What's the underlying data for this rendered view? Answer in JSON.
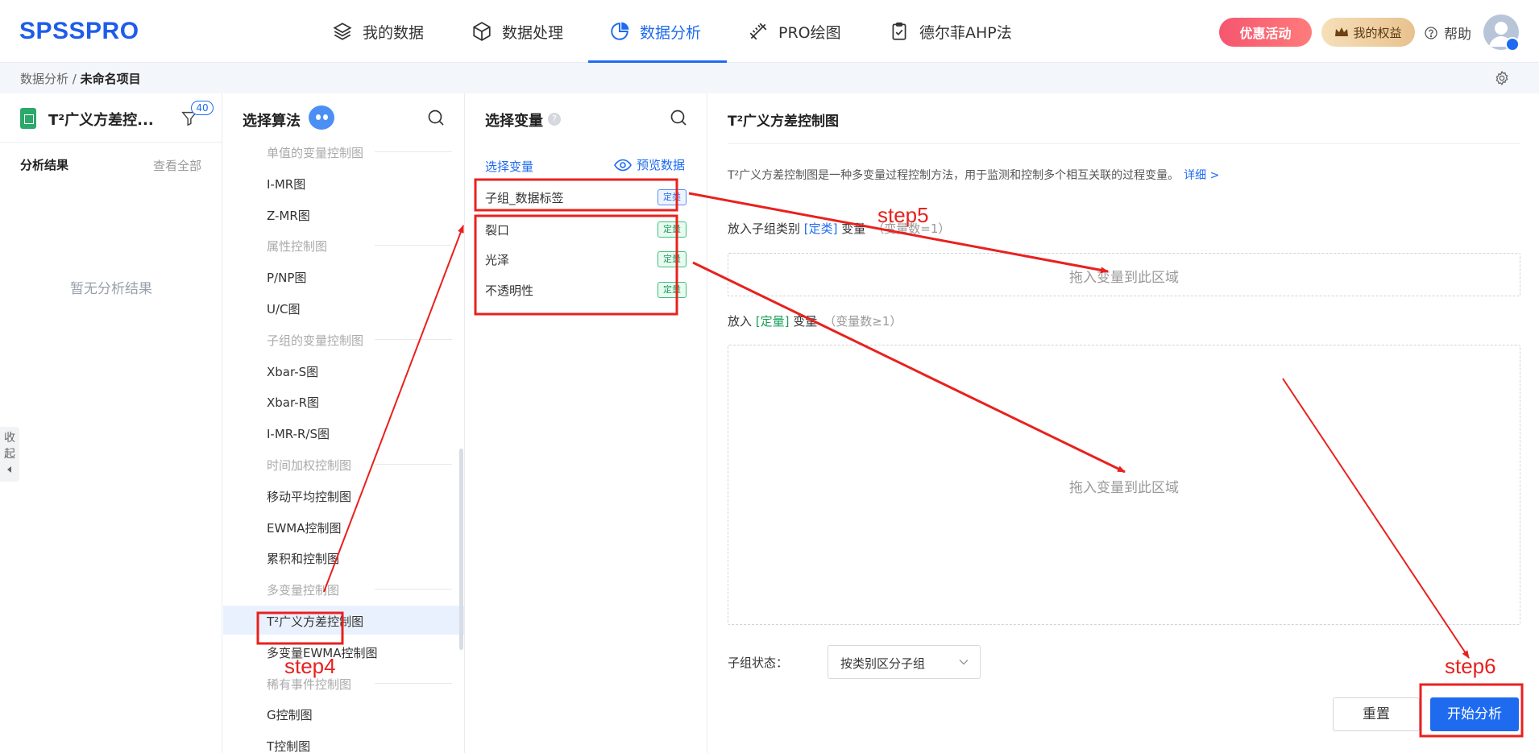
{
  "app": {
    "logo": "SPSSPRO",
    "nav": [
      {
        "label": "我的数据",
        "icon": "layers-icon"
      },
      {
        "label": "数据处理",
        "icon": "cube-icon"
      },
      {
        "label": "数据分析",
        "icon": "pie-chart-icon"
      },
      {
        "label": "PRO绘图",
        "icon": "ruler-pencil-icon"
      },
      {
        "label": "德尔菲AHP法",
        "icon": "clipboard-icon"
      }
    ],
    "active_nav": "数据分析",
    "promo_label": "优惠活动",
    "rights_label": "我的权益",
    "help_label": "帮助",
    "colors": {
      "accent": "#1e6bf0",
      "promo": "#f5566f",
      "category_tag": "#1e6bf0",
      "quantity_tag": "#17a05a",
      "annotation": "#e8211e"
    }
  },
  "breadcrumb": {
    "parent": "数据分析",
    "separator": " / ",
    "current": "未命名项目"
  },
  "left_panel": {
    "project_title": "T²广义方差控...",
    "filter_count": "40",
    "results_title": "分析结果",
    "view_all": "查看全部",
    "empty_text": "暂无分析结果",
    "collapse_label": "收起"
  },
  "algorithms": {
    "title": "选择算法",
    "items": [
      {
        "label": "单值的变量控制图",
        "category": true
      },
      {
        "label": "I-MR图"
      },
      {
        "label": "Z-MR图"
      },
      {
        "label": "属性控制图",
        "category": true
      },
      {
        "label": "P/NP图"
      },
      {
        "label": "U/C图"
      },
      {
        "label": "子组的变量控制图",
        "category": true
      },
      {
        "label": "Xbar-S图"
      },
      {
        "label": "Xbar-R图"
      },
      {
        "label": "I-MR-R/S图"
      },
      {
        "label": "时间加权控制图",
        "category": true
      },
      {
        "label": "移动平均控制图"
      },
      {
        "label": "EWMA控制图"
      },
      {
        "label": "累积和控制图"
      },
      {
        "label": "多变量控制图",
        "category": true
      },
      {
        "label": "T²广义方差控制图",
        "selected": true
      },
      {
        "label": "多变量EWMA控制图"
      },
      {
        "label": "稀有事件控制图",
        "category": true
      },
      {
        "label": "G控制图"
      },
      {
        "label": "T控制图"
      }
    ]
  },
  "variables": {
    "title": "选择变量",
    "help_mark": "?",
    "subtitle": "选择变量",
    "preview_label": "预览数据",
    "items": [
      {
        "name": "子组_数据标签",
        "tag": "定类",
        "kind": "cat"
      },
      {
        "name": "裂口",
        "tag": "定量",
        "kind": "qty"
      },
      {
        "name": "光泽",
        "tag": "定量",
        "kind": "qty"
      },
      {
        "name": "不透明性",
        "tag": "定量",
        "kind": "qty"
      }
    ]
  },
  "config": {
    "title": "T²广义方差控制图",
    "description": "T²广义方差控制图是一种多变量过程控制方法，用于监测和控制多个相互关联的过程变量。",
    "detail_link": "详细 >",
    "zone1": {
      "pre": "放入子组类别 ",
      "type": "[定类]",
      "post": " 变量",
      "count": "（变量数=1）",
      "placeholder": "拖入变量到此区域"
    },
    "zone2": {
      "pre": "放入 ",
      "type": "[定量]",
      "post": " 变量",
      "count": "（变量数≥1）",
      "placeholder": "拖入变量到此区域"
    },
    "subgroup_label": "子组状态：",
    "subgroup_value": "按类别区分子组",
    "reset_label": "重置",
    "start_label": "开始分析"
  },
  "annotations": {
    "step4": "step4",
    "step5": "step5",
    "step6": "step6"
  }
}
